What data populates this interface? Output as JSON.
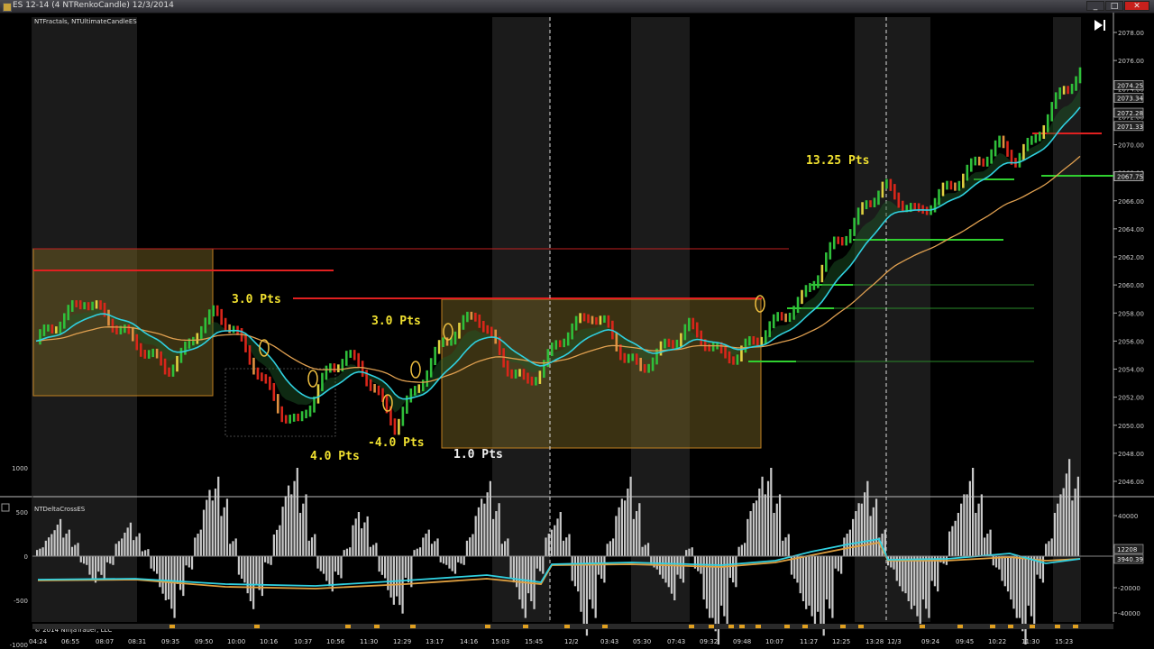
{
  "window": {
    "title": "ES 12-14 (4 NTRenkoCandle)  12/3/2014",
    "minimize_glyph": "_",
    "maximize_glyph": "□",
    "close_glyph": "✕"
  },
  "price_panel": {
    "indicator_label": "NTFractals, NTUltimateCandleES",
    "price_labels": [
      "2074.25",
      "2073.34",
      "2072.28",
      "2071.33",
      "2067.75"
    ],
    "annotations": [
      "3.0 Pts",
      "4.0 Pts",
      "3.0 Pts",
      "-4.0 Pts",
      "1.0 Pts",
      "13.25 Pts"
    ]
  },
  "lower_panel": {
    "indicator_label": "NTDeltaCrossES",
    "right_labels": [
      "12208",
      "3940.39"
    ]
  },
  "footer": {
    "copyright": "© 2014 NinjaTrader, LLC"
  },
  "chart_data": [
    {
      "type": "line",
      "title": "",
      "series": [
        {
          "name": "ES 12-14 (4 NTRenkoCandle)",
          "values": [
            2056,
            2057,
            2058,
            2059,
            2058,
            2057,
            2056,
            2055,
            2054,
            2055,
            2057,
            2058,
            2057,
            2055,
            2053,
            2051,
            2050,
            2052,
            2054,
            2055,
            2054,
            2052,
            2050,
            2052,
            2054,
            2056,
            2057,
            2058,
            2056,
            2054,
            2053,
            2054,
            2056,
            2057,
            2058,
            2057,
            2055,
            2054,
            2055,
            2056,
            2057,
            2056,
            2055,
            2055,
            2056,
            2057,
            2058,
            2059,
            2061,
            2063,
            2064,
            2066,
            2067,
            2066,
            2065,
            2066,
            2067,
            2068,
            2069,
            2070,
            2069,
            2070,
            2072,
            2074,
            2075
          ]
        }
      ],
      "ylim": [
        2045,
        2079
      ],
      "y_ticks": [
        2046,
        2048,
        2050,
        2052,
        2054,
        2056,
        2058,
        2060,
        2062,
        2064,
        2066,
        2068,
        2070,
        2072,
        2074,
        2076,
        2078
      ],
      "x_tick_labels": [
        "04:24",
        "06:55",
        "08:07",
        "08:31",
        "09:35",
        "09:50",
        "10:00",
        "10:16",
        "10:37",
        "10:56",
        "11:30",
        "12:29",
        "13:17",
        "14:16",
        "15:03",
        "15:45",
        "12/2",
        "03:43",
        "05:30",
        "07:43",
        "09:32",
        "09:48",
        "10:07",
        "11:27",
        "12:25",
        "13:28",
        "12/3",
        "09:24",
        "09:45",
        "10:22",
        "11:30",
        "15:23"
      ],
      "colors": {
        "up": "#2fbf3a",
        "down": "#d8261a",
        "fast_ma": "#30d0e0",
        "slow_ma": "#e0a050",
        "resistance": "#e02020",
        "support": "#30d030",
        "box": "#6a5a20"
      }
    },
    {
      "type": "bar",
      "title": "",
      "ylim": [
        -1500,
        1200
      ],
      "y_ticks_left": [
        1000,
        500,
        0,
        -500,
        -1000
      ],
      "y_ticks_right": [
        40000,
        20000,
        -20000,
        -40000
      ],
      "values": [
        100,
        250,
        420,
        300,
        150,
        -100,
        -300,
        -250,
        -100,
        200,
        380,
        260,
        80,
        -200,
        -500,
        -700,
        -450,
        -150,
        300,
        750,
        900,
        650,
        200,
        -300,
        -600,
        -450,
        -100,
        350,
        800,
        1000,
        700,
        250,
        -200,
        -400,
        -250,
        100,
        500,
        450,
        150,
        -250,
        -550,
        -650,
        -350,
        100,
        300,
        200,
        -100,
        -200,
        -100,
        250,
        650,
        850,
        600,
        200,
        -350,
        -700,
        -600,
        -200,
        300,
        500,
        250,
        -400,
        -900,
        -700,
        -300,
        200,
        650,
        900,
        600,
        150,
        -150,
        -300,
        -500,
        -300,
        100,
        -200,
        -700,
        -1000,
        -800,
        -350,
        150,
        600,
        900,
        1000,
        700,
        250,
        -300,
        -600,
        -800,
        -900,
        -700,
        -200,
        300,
        600,
        850,
        650,
        300,
        -150,
        -400,
        -600,
        -800,
        -700,
        -400,
        -100,
        400,
        700,
        1000,
        700,
        300,
        -150,
        -400,
        -700,
        -1000,
        -800,
        -300,
        200,
        700,
        1100,
        900
      ],
      "colors": {
        "bars": "#c8c8c8",
        "line_cyan": "#30d0e0",
        "line_orange": "#e0a040"
      }
    }
  ]
}
